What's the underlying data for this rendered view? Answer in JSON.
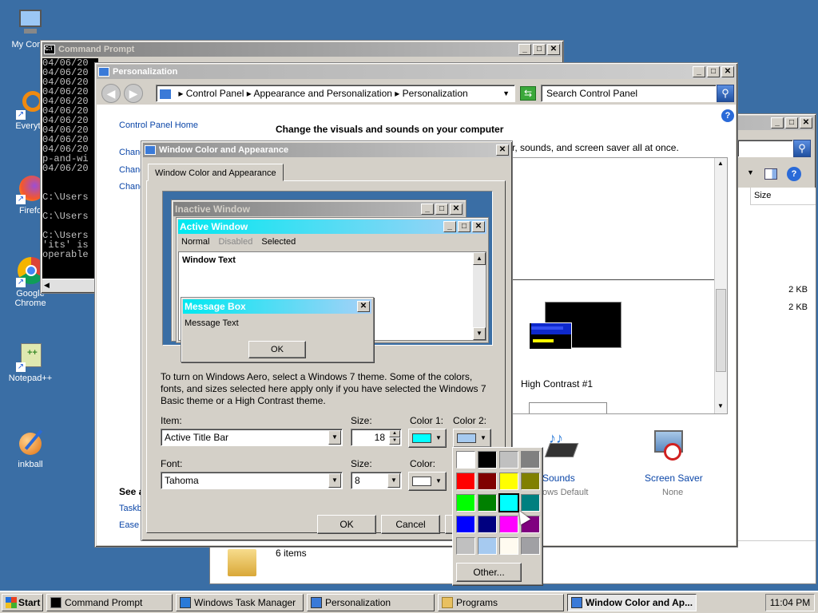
{
  "desktop": {
    "icons": [
      {
        "label": "My Comp"
      },
      {
        "label": "Everyth"
      },
      {
        "label": "Firefo"
      },
      {
        "label": "Google Chrome"
      },
      {
        "label": "Notepad++"
      },
      {
        "label": "inkball"
      }
    ]
  },
  "cmd": {
    "title": "Command Prompt",
    "lines": [
      "04/06/20",
      "04/06/20",
      "04/06/20",
      "04/06/20",
      "04/06/20",
      "04/06/20",
      "04/06/20",
      "04/06/20",
      "04/06/20",
      "04/06/20",
      "p-and-wi",
      "04/06/20",
      "",
      "",
      "C:\\Users",
      "",
      "C:\\Users",
      "",
      "C:\\Users",
      "'its' is",
      "operable"
    ]
  },
  "explorer": {
    "column_size": "Size",
    "sizes": [
      "2 KB",
      "2 KB"
    ],
    "status": "6 items"
  },
  "personalization": {
    "title": "Personalization",
    "breadcrumb": [
      "Control Panel",
      "Appearance and Personalization",
      "Personalization"
    ],
    "search_placeholder": "Search Control Panel",
    "left_home": "Control Panel Home",
    "left_links": [
      "Chang",
      "Chang",
      "Chang"
    ],
    "see_also": "See a",
    "see_links": [
      "Taskb",
      "Ease"
    ],
    "heading": "Change the visuals and sounds on your computer",
    "sub": "r, sounds, and screen saver all at once.",
    "theme_label": "High Contrast #1",
    "sounds_label": "Sounds",
    "sounds_sub": "ows Default",
    "saver_label": "Screen Saver",
    "saver_sub": "None"
  },
  "dialog": {
    "title": "Window Color and Appearance",
    "tab": "Window Color and Appearance",
    "preview": {
      "inactive": "Inactive Window",
      "active": "Active Window",
      "menu_normal": "Normal",
      "menu_disabled": "Disabled",
      "menu_selected": "Selected",
      "window_text": "Window Text",
      "msgbox_title": "Message Box",
      "msgbox_text": "Message Text",
      "ok": "OK"
    },
    "info": "To turn on Windows Aero, select a Windows 7 theme.  Some of the colors, fonts, and sizes selected here apply only if you have selected the Windows 7 Basic theme or a High Contrast theme.",
    "item_label": "Item:",
    "item_value": "Active Title Bar",
    "size_label": "Size:",
    "size_value": "18",
    "color1_label": "Color 1:",
    "color2_label": "Color 2:",
    "font_label": "Font:",
    "font_value": "Tahoma",
    "font_size_label": "Size:",
    "font_size_value": "8",
    "color_label": "Color:",
    "ok": "OK",
    "cancel": "Cancel"
  },
  "palette": {
    "colors": [
      "#ffffff",
      "#000000",
      "#c0c0c0",
      "#808080",
      "#ff0000",
      "#800000",
      "#ffff00",
      "#808000",
      "#00ff00",
      "#008000",
      "#00ffff",
      "#008080",
      "#0000ff",
      "#000080",
      "#ff00ff",
      "#800080",
      "#c0c0c0",
      "#a6caf0",
      "#fffbf0",
      "#a0a0a4"
    ],
    "selected_index": 10,
    "other": "Other..."
  },
  "taskbar": {
    "start": "Start",
    "items": [
      "Command Prompt",
      "Windows Task Manager",
      "Personalization",
      "Programs",
      "Window Color and Ap..."
    ],
    "clock": "11:04 PM"
  }
}
